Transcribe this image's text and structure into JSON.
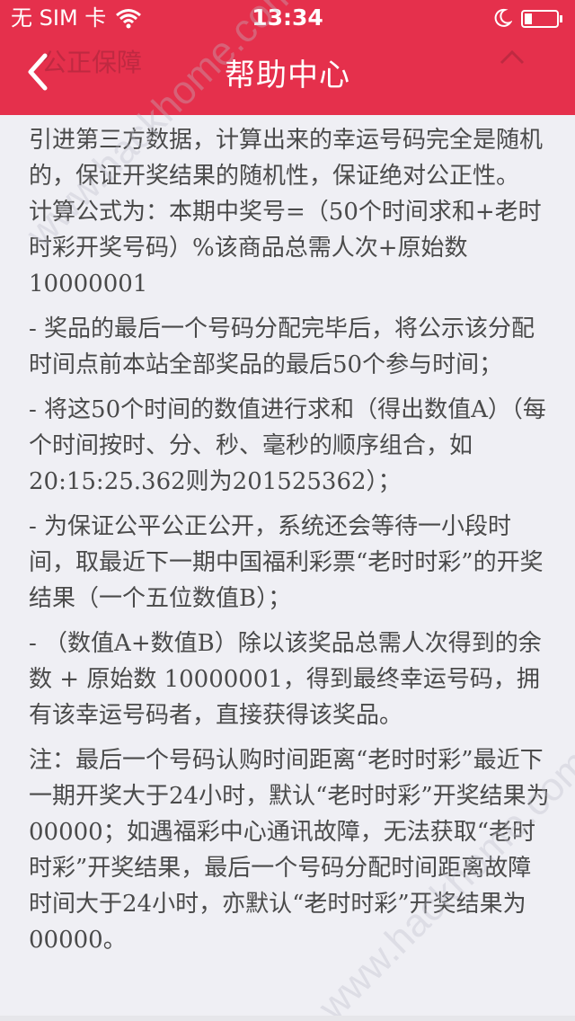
{
  "status_bar": {
    "carrier": "无 SIM 卡",
    "time": "13:34"
  },
  "nav": {
    "title": "帮助中心",
    "background_title": "公正保障",
    "back_icon": "chevron-left-icon"
  },
  "content": {
    "paragraphs": [
      "引进第三方数据，计算出来的幸运号码完全是随机的，保证开奖结果的随机性，保证绝对公正性。 计算公式为：本期中奖号=（50个时间求和+老时时彩开奖号码）%该商品总需人次+原始数10000001",
      "- 奖品的最后一个号码分配完毕后，将公示该分配时间点前本站全部奖品的最后50个参与时间；",
      "- 将这50个时间的数值进行求和（得出数值A）（每个时间按时、分、秒、毫秒的顺序组合，如20:15:25.362则为201525362）；",
      "- 为保证公平公正公开，系统还会等待一小段时间，取最近下一期中国福利彩票“老时时彩”的开奖结果（一个五位数值B）；",
      "- （数值A+数值B）除以该奖品总需人次得到的余数 + 原始数 10000001，得到最终幸运号码，拥有该幸运号码者，直接获得该奖品。",
      "注：最后一个号码认购时间距离“老时时彩”最近下一期开奖大于24小时，默认“老时时彩”开奖结果为00000；如遇福彩中心通讯故障，无法获取“老时时彩”开奖结果，最后一个号码分配时间距离故障时间大于24小时，亦默认“老时时彩”开奖结果为00000。"
    ]
  },
  "watermark": {
    "text": "www.hackhome.com"
  },
  "colors": {
    "header": "#e5304c",
    "body_bg": "#efeff4",
    "text": "#4a4a4a"
  }
}
